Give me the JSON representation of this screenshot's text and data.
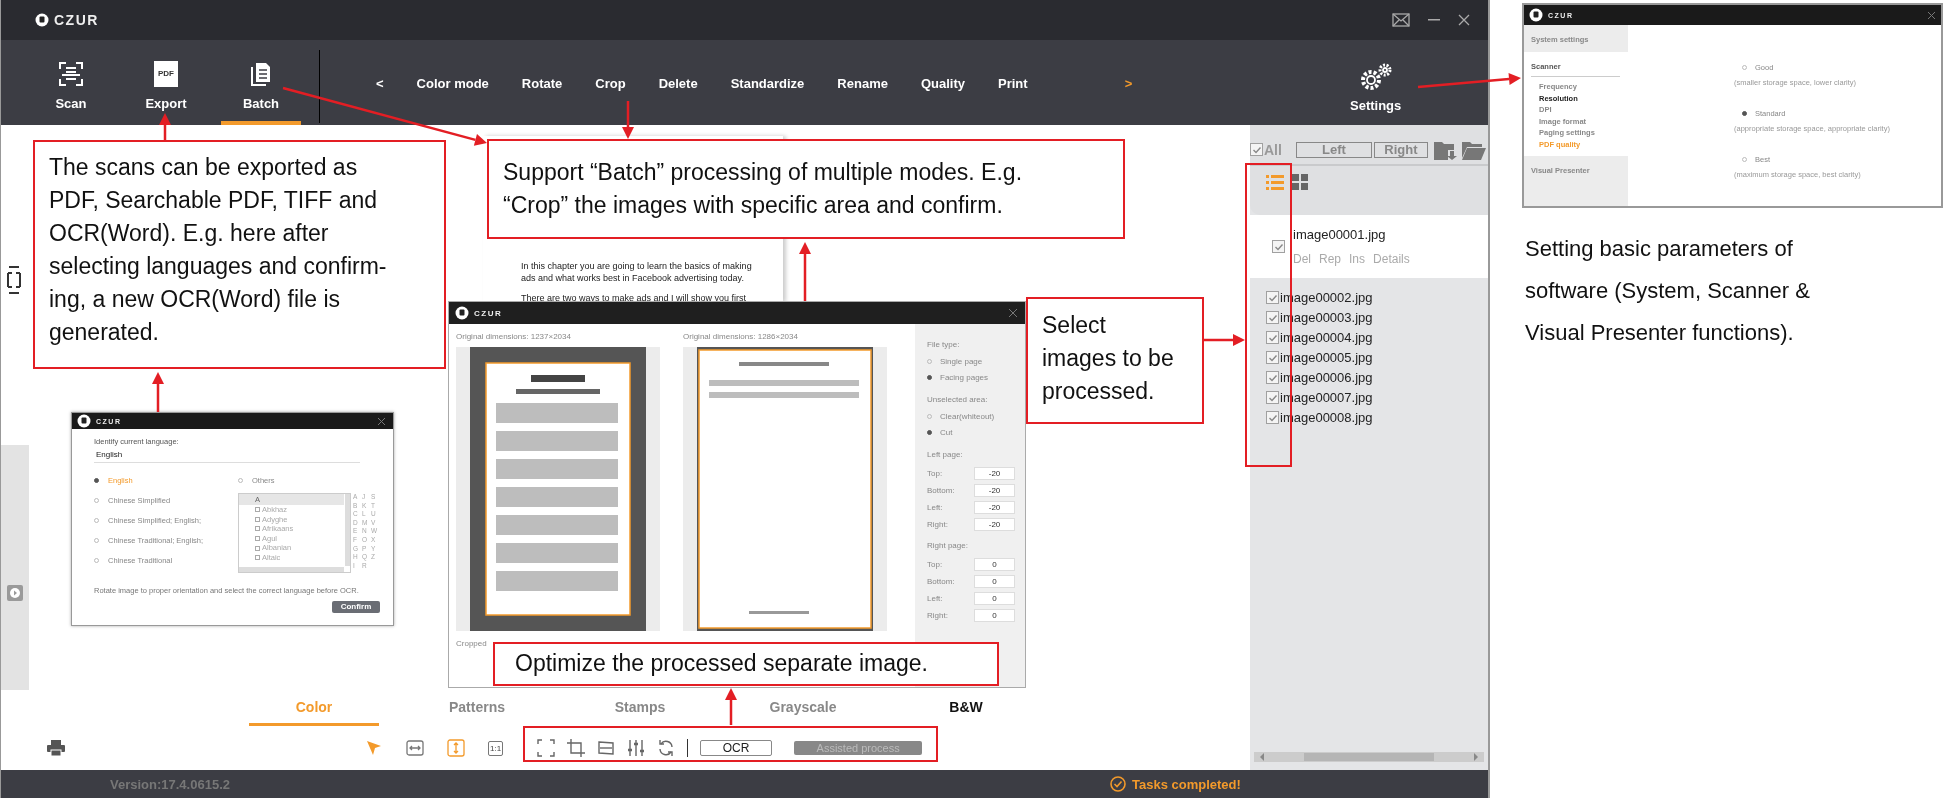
{
  "window": {
    "logo": "CZUR"
  },
  "toolbar": {
    "main": [
      {
        "label": "Scan",
        "kind": "scan",
        "selected": false
      },
      {
        "label": "Export",
        "kind": "pdf",
        "icon_label": "PDF",
        "selected": false
      },
      {
        "label": "Batch",
        "kind": "batch",
        "selected": true
      }
    ],
    "prev": "<",
    "modes": [
      "Color mode",
      "Rotate",
      "Crop",
      "Delete",
      "Standardize",
      "Rename",
      "Quality",
      "Print"
    ],
    "next": ">",
    "settings": "Settings"
  },
  "preview": {
    "text": "In this chapter you are going to learn the basics of making ads and what works best in Facebook advertising today.",
    "text_2": "There are two ways to make ads and I will show you first"
  },
  "language_dialog": {
    "logo": "CZUR",
    "prompt": "Identify current language:",
    "value": "English",
    "languages": [
      {
        "label": "English",
        "selected": true
      },
      {
        "label": "Chinese Simplified",
        "selected": false
      },
      {
        "label": "Chinese Simplified; English;",
        "selected": false
      },
      {
        "label": "Chinese Traditional; English;",
        "selected": false
      },
      {
        "label": "Chinese Traditional",
        "selected": false
      }
    ],
    "others": {
      "label": "Others",
      "selected": false
    },
    "list_header": "A",
    "list": [
      "Abkhaz",
      "Adyghe",
      "Afrikaans",
      "Agul",
      "Albanian",
      "Altaic"
    ],
    "letters": [
      "A",
      "J",
      "S",
      "B",
      "K",
      "T",
      "C",
      "L",
      "U",
      "D",
      "M",
      "V",
      "E",
      "N",
      "W",
      "F",
      "O",
      "X",
      "G",
      "P",
      "Y",
      "H",
      "Q",
      "Z",
      "I",
      "R"
    ],
    "note": "Rotate image to proper orientation and select the correct language before OCR.",
    "confirm": "Confirm"
  },
  "crop_dialog": {
    "logo": "CZUR",
    "pages": [
      {
        "caption": "Original dimensions: 1237×2034",
        "kind": "picture",
        "cropped": "Cropped"
      },
      {
        "caption": "Original dimensions: 1286×2034",
        "kind": "picture"
      }
    ],
    "file_type": {
      "label": "File type:",
      "options": [
        {
          "label": "Single page",
          "selected": false
        },
        {
          "label": "Facing pages",
          "selected": true
        }
      ]
    },
    "unselected_area": {
      "label": "Unselected area:",
      "options": [
        {
          "label": "Clear(whiteout)",
          "selected": false
        },
        {
          "label": "Cut",
          "selected": true
        }
      ]
    },
    "margins": [
      {
        "label": "Left page:",
        "fields": [
          {
            "label": "Top:",
            "value": "-20"
          },
          {
            "label": "Bottom:",
            "value": "-20"
          },
          {
            "label": "Left:",
            "value": "-20"
          },
          {
            "label": "Right:",
            "value": "-20"
          }
        ]
      },
      {
        "label": "Right page:",
        "fields": [
          {
            "label": "Top:",
            "value": "0"
          },
          {
            "label": "Bottom:",
            "value": "0"
          },
          {
            "label": "Left:",
            "value": "0"
          },
          {
            "label": "Right:",
            "value": "0"
          }
        ]
      }
    ]
  },
  "filters": [
    {
      "label": "Color",
      "selected": true,
      "emphasized": false
    },
    {
      "label": "Patterns",
      "selected": false,
      "emphasized": false
    },
    {
      "label": "Stamps",
      "selected": false,
      "emphasized": false
    },
    {
      "label": "Grayscale",
      "selected": false,
      "emphasized": false
    },
    {
      "label": "B&W",
      "selected": false,
      "emphasized": true
    }
  ],
  "view_tools": [
    {
      "kind": "pointer",
      "selected": true
    },
    {
      "kind": "fit-width",
      "selected": false
    },
    {
      "kind": "fit-height",
      "selected": true
    },
    {
      "kind": "actual-size",
      "label": "1:1",
      "selected": false
    }
  ],
  "edit_tools": [
    {
      "kind": "select-area"
    },
    {
      "kind": "crop"
    },
    {
      "kind": "deskew"
    },
    {
      "kind": "adjust"
    },
    {
      "kind": "rotate"
    }
  ],
  "ocr_button": "OCR",
  "assist_button": {
    "label": "Assisted process",
    "disabled": true
  },
  "sidebar": {
    "all": {
      "label": "All",
      "checked": true
    },
    "left": "Left",
    "right": "Right",
    "views": [
      {
        "kind": "list",
        "selected": true
      },
      {
        "kind": "grid",
        "selected": false
      }
    ],
    "files": [
      {
        "name": "image00001.jpg",
        "checked": true,
        "selected": true,
        "actions": [
          "Del",
          "Rep",
          "Ins",
          "Details"
        ]
      },
      {
        "name": "image00002.jpg",
        "checked": true,
        "selected": false
      },
      {
        "name": "image00003.jpg",
        "checked": true,
        "selected": false
      },
      {
        "name": "image00004.jpg",
        "checked": true,
        "selected": false
      },
      {
        "name": "image00005.jpg",
        "checked": true,
        "selected": false
      },
      {
        "name": "image00006.jpg",
        "checked": true,
        "selected": false
      },
      {
        "name": "image00007.jpg",
        "checked": true,
        "selected": false
      },
      {
        "name": "image00008.jpg",
        "checked": true,
        "selected": false
      }
    ]
  },
  "status": {
    "version": "Version:17.4.0615.2",
    "message": "Tasks completed!"
  },
  "settings_dialog": {
    "logo": "CZUR",
    "nav": [
      {
        "label": "System settings",
        "kind": "section",
        "selected": false
      },
      {
        "label": "Scanner",
        "kind": "section",
        "selected": true
      },
      {
        "label": "Frequency",
        "kind": "item",
        "selected": false
      },
      {
        "label": "Resolution",
        "kind": "group",
        "selected": false
      },
      {
        "label": "DPI",
        "kind": "item",
        "selected": false
      },
      {
        "label": "Image format",
        "kind": "item",
        "selected": false
      },
      {
        "label": "Paging settings",
        "kind": "item",
        "selected": false
      },
      {
        "label": "PDF quality",
        "kind": "item",
        "selected": true
      },
      {
        "label": "Visual Presenter",
        "kind": "section",
        "selected": false
      }
    ],
    "options": [
      {
        "label": "Good",
        "hint": "(smaller storage space, lower clarity)",
        "selected": false
      },
      {
        "label": "Standard",
        "hint": "(appropriate storage space, appropriate clarity)",
        "selected": true
      },
      {
        "label": "Best",
        "hint": "(maximum storage space, best clarity)",
        "selected": false
      }
    ]
  },
  "notes": {
    "export": "The scans can be exported as PDF, Searchable PDF, TIFF and OCR(Word). E.g. here after selecting languages and confirm-ing, a new OCR(Word) file is generated.",
    "batch": "Support “Batch” processing of multiple modes. E.g. “Crop” the images with specific area and confirm.",
    "select": "Select images to be processed.",
    "optimize": "Optimize the processed separate image.",
    "settings": "Setting basic parameters of software (System, Scanner & Visual Presenter functions)."
  }
}
